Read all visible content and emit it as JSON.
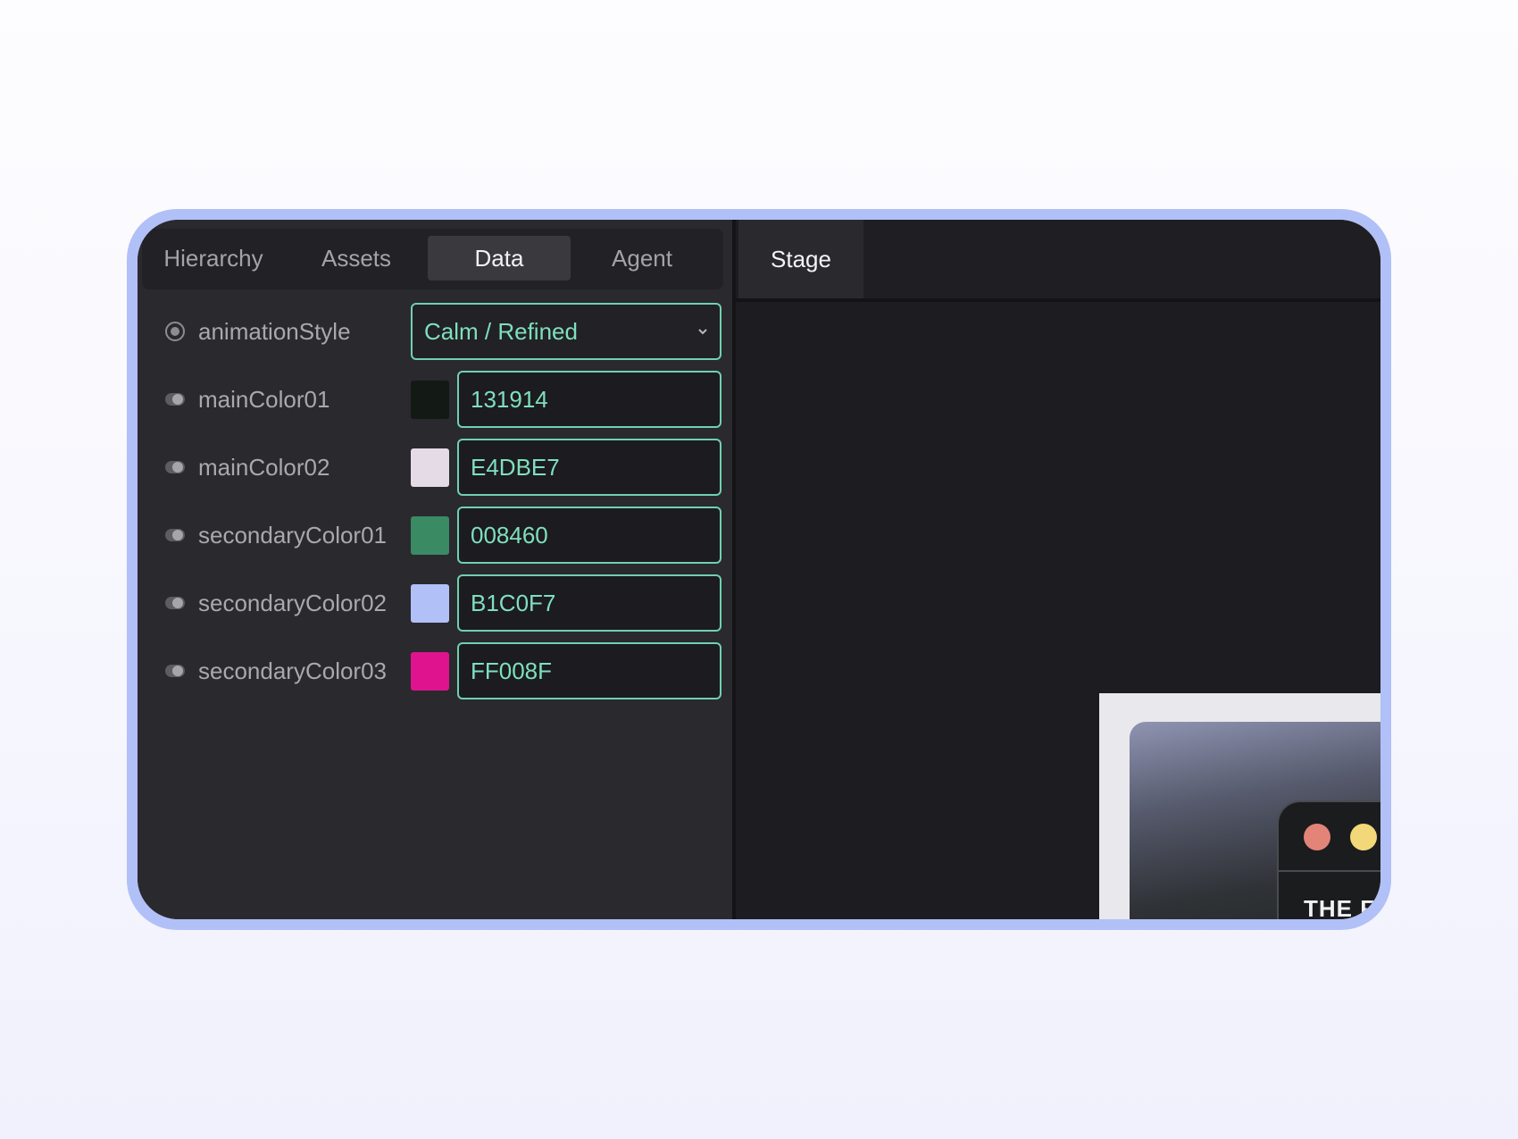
{
  "tabs": [
    {
      "label": "Hierarchy"
    },
    {
      "label": "Assets"
    },
    {
      "label": "Data"
    },
    {
      "label": "Agent"
    }
  ],
  "active_tab": "Data",
  "stage_tab": {
    "label": "Stage"
  },
  "fields": {
    "animation_style": {
      "label": "animationStyle",
      "value": "Calm / Refined",
      "icon": "radio-icon"
    },
    "colors": [
      {
        "label": "mainColor01",
        "value": "131914",
        "swatch": "#131914",
        "icon": "toggle-icon"
      },
      {
        "label": "mainColor02",
        "value": "E4DBE7",
        "swatch": "#E4DBE7",
        "icon": "toggle-icon"
      },
      {
        "label": "secondaryColor01",
        "value": "008460",
        "swatch": "#3A8A63",
        "icon": "toggle-icon"
      },
      {
        "label": "secondaryColor02",
        "value": "B1C0F7",
        "swatch": "#B1C0F7",
        "icon": "toggle-icon"
      },
      {
        "label": "secondaryColor03",
        "value": "FF008F",
        "swatch": "#E0138E",
        "icon": "toggle-icon"
      }
    ]
  },
  "preview": {
    "text": "THE F",
    "dots": [
      "#e38479",
      "#f2d878"
    ]
  },
  "colors": {
    "frame_border": "#b1c0f7",
    "accent": "#7ee0bd",
    "panel_bg": "#2a292e",
    "stage_bg": "#1d1c20"
  }
}
